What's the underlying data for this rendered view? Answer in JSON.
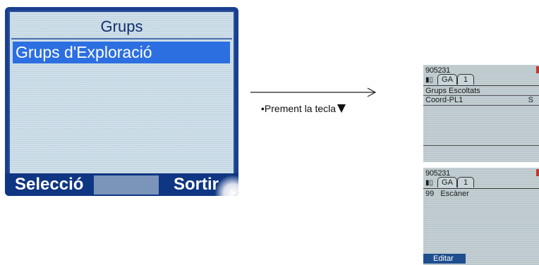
{
  "main_screen": {
    "title": "Grups",
    "selected_item": "Grups d'Exploració",
    "softkey_left": "Selecció",
    "softkey_right": "Sortir"
  },
  "instruction": {
    "text": "•Prement la tecla",
    "key_symbol": "down-triangle"
  },
  "screen_top": {
    "number": "905231",
    "tabs": [
      "GA",
      "1"
    ],
    "header": "Grups Escoltats",
    "row_left": "Coord-PL1",
    "row_right": "S"
  },
  "screen_bottom": {
    "number": "905231",
    "tabs": [
      "GA",
      "1"
    ],
    "row_number": "99",
    "row_label": "Escàner",
    "softkey": "Editar"
  },
  "colors": {
    "handset_frame": "#1a3f8f",
    "lcd_background": "#cfe0ea",
    "highlight": "#2c6fe0",
    "softkey_bar": "#0f3682",
    "mini_lcd": "#c3cfd3",
    "mini_softkey": "#1f4e8f"
  }
}
